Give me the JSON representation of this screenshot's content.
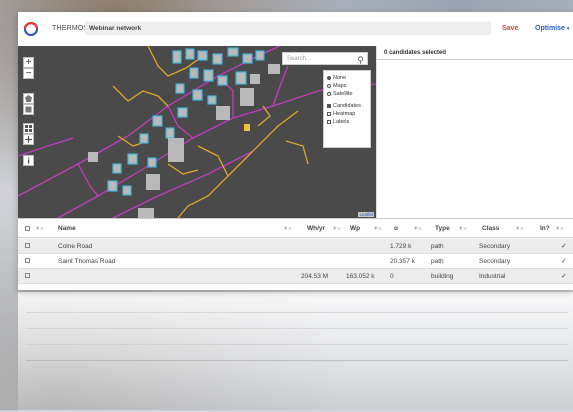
{
  "app": {
    "name": "THERMOS",
    "project_name": "Webinar network",
    "save_label": "Save",
    "optimise_label": "Optimise",
    "optimise_caret": "▾"
  },
  "map": {
    "search_placeholder": "Search...",
    "zoom_in": "+",
    "zoom_out": "−",
    "basemap_options": [
      "None",
      "Maps",
      "Satellite"
    ],
    "basemap_selected": "None",
    "overlay_options": [
      "Candidates",
      "Heatmap",
      "Labels"
    ],
    "overlay_checked": [
      "Candidates"
    ],
    "attribution": "Leaflet",
    "colors": {
      "background": "#4a4a4a",
      "building_outline": "#3fb6d9",
      "building_fill": "#b9b9b9",
      "path": "#e0a52a",
      "road": "#c13cc1"
    }
  },
  "side_panel": {
    "header": "0 candidates selected"
  },
  "table": {
    "columns": [
      {
        "label": "Name",
        "filter": "▼≡"
      },
      {
        "label": "Wh/yr",
        "filter": "▼≡"
      },
      {
        "label": "Wp",
        "filter": "▼≡"
      },
      {
        "label": "ɑ",
        "filter": "▼≡"
      },
      {
        "label": "Type",
        "filter": "▼≡"
      },
      {
        "label": "Class",
        "filter": "▼≡"
      },
      {
        "label": "In?",
        "filter": "▼≡"
      }
    ],
    "select_filter": "▼≡",
    "rows": [
      {
        "name": "Colne Road",
        "whyr": "",
        "wp": "",
        "alpha": "1.729 k",
        "type": "path",
        "class": "Secondary",
        "in": "✓"
      },
      {
        "name": "Saint Thomas Road",
        "whyr": "",
        "wp": "",
        "alpha": "20.357 k",
        "type": "path",
        "class": "Secondary",
        "in": "✓"
      },
      {
        "name": "",
        "whyr": "204.53 M",
        "wp": "163.052 k",
        "alpha": "0",
        "type": "building",
        "class": "Industrial",
        "in": "✓"
      }
    ]
  }
}
